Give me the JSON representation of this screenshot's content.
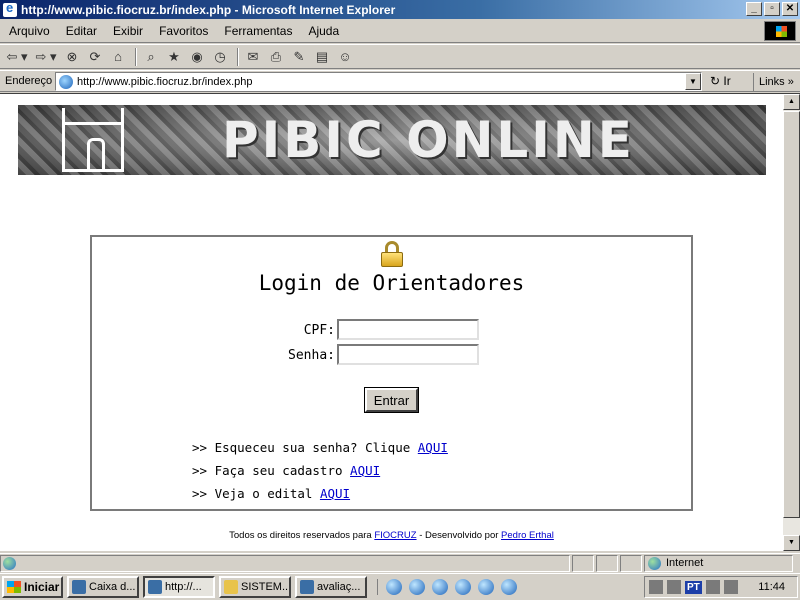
{
  "window": {
    "title": "http://www.pibic.fiocruz.br/index.php - Microsoft Internet Explorer",
    "min": "_",
    "max": "▫",
    "close": "✕"
  },
  "menu": [
    "Arquivo",
    "Editar",
    "Exibir",
    "Favoritos",
    "Ferramentas",
    "Ajuda"
  ],
  "address": {
    "label": "Endereço",
    "url": "http://www.pibic.fiocruz.br/index.php",
    "go": "Ir",
    "links": "Links"
  },
  "banner": {
    "title": "PIBIC ONLINE"
  },
  "login": {
    "title": "Login de Orientadores",
    "cpf_label": "CPF:",
    "cpf_value": "",
    "senha_label": "Senha:",
    "senha_value": "",
    "submit": "Entrar",
    "links": [
      {
        "prefix": ">> Esqueceu sua senha? Clique ",
        "link": "AQUI"
      },
      {
        "prefix": ">> Faça seu cadastro ",
        "link": "AQUI"
      },
      {
        "prefix": ">> Veja o edital ",
        "link": "AQUI"
      }
    ]
  },
  "footer": {
    "text1": "Todos os direitos reservados para ",
    "link1": "FIOCRUZ",
    "text2": " - Desenvolvido por ",
    "link2": "Pedro Erthal"
  },
  "status": {
    "zone": "Internet"
  },
  "taskbar": {
    "start": "Iniciar",
    "tasks": [
      "Caixa d...",
      "http://...",
      "SISTEM...",
      "avaliaç..."
    ],
    "lang": "PT",
    "clock": "11:44"
  }
}
